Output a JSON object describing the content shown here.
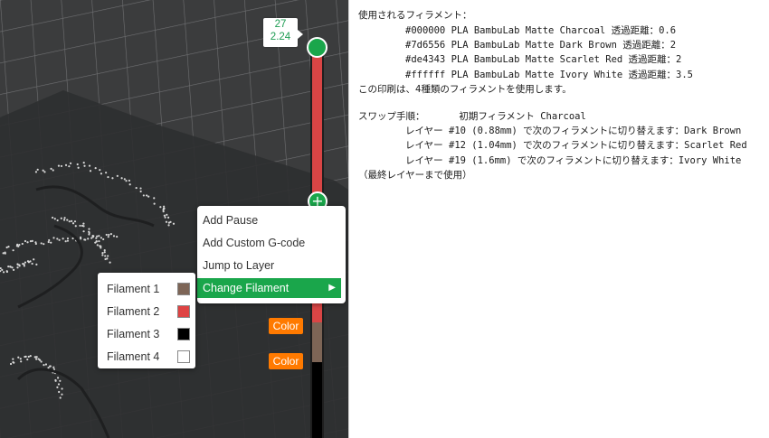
{
  "slider": {
    "layer_number": "27",
    "layer_height": "2.24",
    "color_tag_label": "Color",
    "segment_colors": [
      "#d94545",
      "#7d6556",
      "#000000"
    ]
  },
  "context_menu": {
    "items": [
      "Add Pause",
      "Add Custom G-code",
      "Jump to Layer",
      "Change Filament"
    ],
    "highlight_color": "#1aa64b"
  },
  "filament_menu": {
    "items": [
      {
        "label": "Filament 1",
        "color": "#7d6556"
      },
      {
        "label": "Filament 2",
        "color": "#de4343"
      },
      {
        "label": "Filament 3",
        "color": "#000000"
      },
      {
        "label": "Filament 4",
        "color": "#ffffff"
      }
    ]
  },
  "summary": {
    "filaments_header": "使用されるフィラメント：",
    "filament_lines": [
      "#000000 PLA BambuLab Matte Charcoal 透過距離：0.6",
      "#7d6556 PLA BambuLab Matte Dark Brown 透過距離：2",
      "#de4343 PLA BambuLab Matte Scarlet Red 透過距離：2",
      "#ffffff PLA BambuLab Matte Ivory White 透過距離：3.5"
    ],
    "count_line": "この印刷は、4種類のフィラメントを使用します。",
    "swap_header": "スワップ手順：      初期フィラメント Charcoal",
    "swap_lines": [
      "レイヤー #10 (0.88mm) で次のフィラメントに切り替えます：Dark Brown",
      "レイヤー #12 (1.04mm) で次のフィラメントに切り替えます：Scarlet Red",
      "レイヤー #19 (1.6mm) で次のフィラメントに切り替えます：Ivory White"
    ],
    "footer": "（最終レイヤーまで使用）"
  }
}
